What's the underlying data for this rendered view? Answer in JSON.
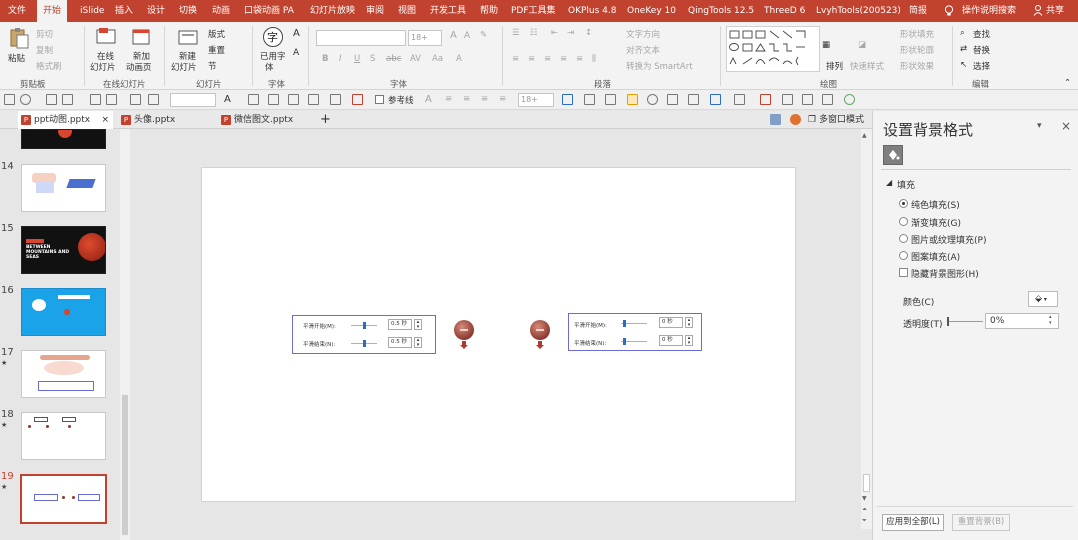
{
  "menubar": {
    "tabs": [
      "文件",
      "开始",
      "iSlide",
      "插入",
      "设计",
      "切换",
      "动画",
      "口袋动画 PA",
      "幻灯片放映",
      "审阅",
      "视图",
      "开发工具",
      "帮助",
      "PDF工具集",
      "OKPlus 4.8",
      "OneKey 10",
      "QingTools 12.5",
      "ThreeD 6",
      "LvyhTools(200523)",
      "简报"
    ],
    "active_tab": "开始",
    "search_label": "操作说明搜索",
    "share_label": "共享"
  },
  "ribbon": {
    "clipboard": {
      "paste": "粘贴",
      "cut": "剪切",
      "copy": "复制",
      "format_painter": "格式刷",
      "group": "剪贴板"
    },
    "online": {
      "online_slide": "在线",
      "online_slide2": "幻灯片",
      "new_anim": "新加",
      "new_anim2": "动画页",
      "group": "在线幻灯片"
    },
    "slides": {
      "new_slide": "新建",
      "new_slide2": "幻灯片",
      "layout": "版式",
      "reset": "重置",
      "section": "节",
      "group": "幻灯片"
    },
    "font_group": {
      "use_font": "已用字",
      "use_font2": "体",
      "group": "字体",
      "size": "18+"
    },
    "font": {
      "group": "字体"
    },
    "paragraph": {
      "text_dir": "文字方向",
      "align_text": "对齐文本",
      "smartart": "转换为 SmartArt",
      "group": "段落"
    },
    "drawing": {
      "arrange": "排列",
      "quick_styles": "快速样式",
      "fill": "形状填充",
      "outline": "形状轮廓",
      "effects": "形状效果",
      "group": "绘图"
    },
    "editing": {
      "find": "查找",
      "replace": "替换",
      "select": "选择",
      "group": "编辑"
    }
  },
  "quicktoolbar": {
    "size": "18+",
    "guide": "参考线"
  },
  "doc_tabs": [
    "ppt动图.pptx",
    "头像.pptx",
    "微信图文.pptx"
  ],
  "multiwindow": "多窗口模式",
  "thumbnails": {
    "numbers": [
      "14",
      "15",
      "16",
      "17",
      "18",
      "19"
    ],
    "stars": [
      "★",
      "★",
      "★"
    ],
    "slide15_text": "BETWEEN MOUNTAINS AND SEAS"
  },
  "slide": {
    "left_panel": {
      "row1_label": "平滑开始(M):",
      "row1_value": "0.5 秒",
      "row2_label": "平滑结束(N):",
      "row2_value": "0.5 秒"
    },
    "right_panel": {
      "row1_label": "平滑开始(M):",
      "row1_value": "0 秒",
      "row2_label": "平滑结束(N):",
      "row2_value": "0 秒"
    }
  },
  "format_pane": {
    "title": "设置背景格式",
    "section": "填充",
    "options": [
      "纯色填充(S)",
      "渐变填充(G)",
      "图片或纹理填充(P)",
      "图案填充(A)"
    ],
    "selected_option": 0,
    "hide_bg_graphics": "隐藏背景图形(H)",
    "color_label": "颜色(C)",
    "transparency_label": "透明度(T)",
    "transparency_value": "0%",
    "apply_all": "应用到全部(L)",
    "reset_bg": "重置背景(B)"
  },
  "colors": {
    "accent": "#c1432f",
    "panel_border": "#6b6bd6",
    "slide_thumb_blue": "#1aa3e8"
  }
}
